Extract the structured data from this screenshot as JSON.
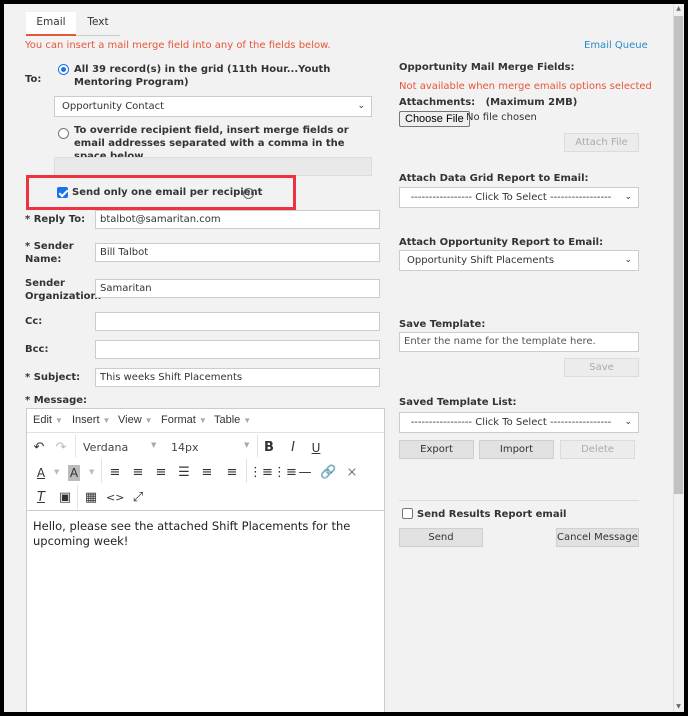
{
  "tabs": [
    {
      "label": "Email",
      "active": true
    },
    {
      "label": "Text",
      "active": false
    }
  ],
  "notice": "You can insert a mail merge field into any of the fields below.",
  "email_queue_link": "Email Queue",
  "to": {
    "label": "To:",
    "option_all": "All 39 record(s) in the grid (11th Hour...Youth Mentoring Program)",
    "option_all_selected": true,
    "recipient_field": "Opportunity Contact",
    "option_override": "To override recipient field, insert merge fields or email addresses separated with a comma in the space below",
    "override_value": ""
  },
  "one_email_per_recipient": {
    "label": "Send only one email per recipient",
    "checked": true,
    "help_icon": "?"
  },
  "fields": {
    "reply_to": {
      "label": "* Reply To:",
      "value": "btalbot@samaritan.com"
    },
    "sender_name": {
      "label_line1": "* Sender",
      "label_line2": "Name:",
      "value": "Bill Talbot"
    },
    "sender_org": {
      "label_line1": "Sender",
      "label_line2": "Organization:",
      "value": "Samaritan"
    },
    "cc": {
      "label": "Cc:",
      "value": ""
    },
    "bcc": {
      "label": "Bcc:",
      "value": ""
    },
    "subject": {
      "label": "* Subject:",
      "value": "This weeks Shift Placements"
    },
    "message": {
      "label": "* Message:"
    }
  },
  "editor": {
    "menus": [
      "Edit",
      "Insert",
      "View",
      "Format",
      "Table"
    ],
    "font": "Verdana",
    "size": "14px",
    "bold": "B",
    "italic": "I",
    "underline": "U",
    "content": "Hello, please see the attached Shift Placements for the upcoming week!"
  },
  "right": {
    "merge_fields_label": "Opportunity Mail Merge Fields:",
    "merge_fields_notice": "Not available when merge emails options selected",
    "attachments_label": "Attachments:   (Maximum 2MB)",
    "choose_file": "Choose File",
    "no_file": "No file chosen",
    "attach_file": "Attach File",
    "data_grid_report_label": "Attach Data Grid Report to Email:",
    "data_grid_report_value": "----------------- Click To Select -----------------",
    "opportunity_report_label": "Attach Opportunity Report to Email:",
    "opportunity_report_value": "Opportunity Shift Placements",
    "save_template_label": "Save Template:",
    "save_template_placeholder": "Enter the name for the template here.",
    "save_button": "Save",
    "saved_template_list_label": "Saved Template List:",
    "saved_template_list_value": "----------------- Click To Select -----------------",
    "export_button": "Export",
    "import_button": "Import",
    "delete_button": "Delete",
    "send_results_label": "Send Results Report email",
    "send_results_checked": false,
    "send_button": "Send",
    "cancel_button": "Cancel Message"
  },
  "colors": {
    "accent_orange": "#e8563a",
    "link_blue": "#2a8bc7",
    "highlight_red": "#ee3340",
    "check_blue": "#1a73e8"
  }
}
